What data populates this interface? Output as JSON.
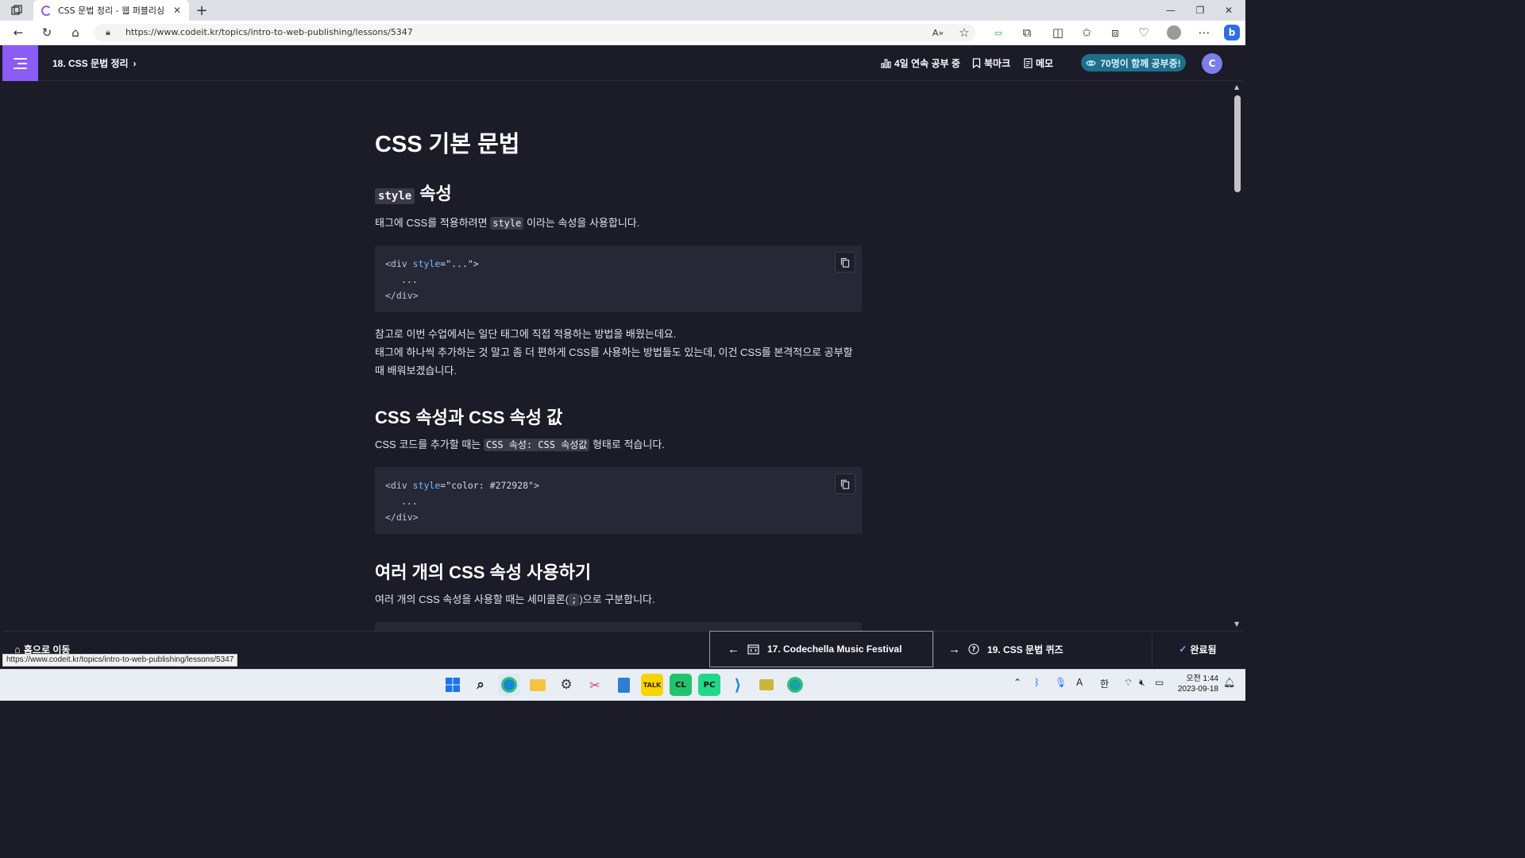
{
  "browser": {
    "tab_title": "CSS 문법 정리 - 웹 퍼블리싱 시작",
    "url": "https://www.codeit.kr/topics/intro-to-web-publishing/lessons/5347",
    "status_url": "https://www.codeit.kr/topics/intro-to-web-publishing/lessons/5347"
  },
  "header": {
    "lesson": "18. CSS 문법 정리",
    "streak": "4일 연속 공부 중",
    "bookmark": "북마크",
    "memo": "메모",
    "together": "70명이 함께 공부중!",
    "avatar_letter": "C"
  },
  "content": {
    "title": "CSS 기본 문법",
    "section1": {
      "heading_code": "style",
      "heading_text": "속성",
      "p_before": "태그에 CSS를 적용하려면",
      "p_code": "style",
      "p_after": "이라는 속성을 사용합니다.",
      "code": {
        "l1_tag_open": "<div",
        "l1_attr": "style",
        "l1_val": "=\"...\">",
        "l2": "...",
        "l3": "</div>"
      }
    },
    "note": {
      "line1": "참고로 이번 수업에서는 일단 태그에 직접 적용하는 방법을 배웠는데요.",
      "line2": "태그에 하나씩 추가하는 것 말고 좀 더 편하게 CSS를 사용하는 방법들도 있는데, 이건 CSS를 본격적으로 공부할 때 배워보겠습니다."
    },
    "section2": {
      "heading": "CSS 속성과 CSS 속성 값",
      "p_before": "CSS 코드를 추가할 때는",
      "p_code": "CSS 속성: CSS 속성값",
      "p_after": "형태로 적습니다.",
      "code": {
        "l1_tag_open": "<div",
        "l1_attr": "style",
        "l1_val": "=\"color: #272928\">",
        "l2": "...",
        "l3": "</div>"
      }
    },
    "section3": {
      "heading": "여러 개의 CSS 속성 사용하기",
      "p_before": "여러 개의 CSS 속성을 사용할 때는 세미콜론(",
      "p_code": ";",
      "p_after": ")으로 구분합니다."
    }
  },
  "footer": {
    "home": "홈으로 이동",
    "prev": "17. Codechella Music Festival",
    "next": "19. CSS 문법 퀴즈",
    "done": "완료됨"
  },
  "taskbar": {
    "ime": "한",
    "time": "오전 1:44",
    "date": "2023-09-18"
  },
  "colors": {
    "accent": "#8b5cf6",
    "background": "#1b1c27",
    "code_bg": "#262836",
    "together_bg": "#1f6e8a"
  }
}
